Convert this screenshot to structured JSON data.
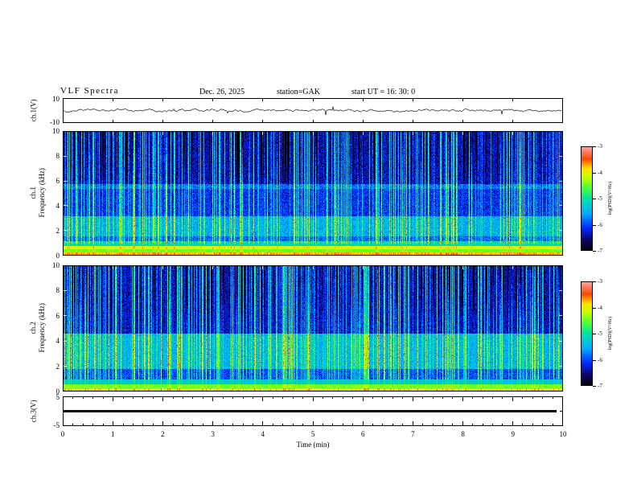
{
  "header": {
    "title": "VLF  Spectra",
    "date": "Dec. 26,  2025",
    "station": "station=GAK",
    "start_ut": "start UT  =   16: 30: 0"
  },
  "axes": {
    "x": {
      "label": "Time  (min)",
      "ticks": [
        "0",
        "1",
        "2",
        "3",
        "4",
        "5",
        "6",
        "7",
        "8",
        "9",
        "10"
      ],
      "lim": [
        0,
        10
      ]
    },
    "waveform_y": {
      "label": "ch.1(V)",
      "ticks": [
        "10",
        "-10"
      ],
      "lim": [
        -10,
        10
      ]
    },
    "spec1_y": {
      "label_channel": "ch.1",
      "label_axis": "Frequency (kHz)",
      "ticks": [
        "10",
        "8",
        "6",
        "4",
        "2",
        "0"
      ],
      "lim": [
        0,
        10
      ]
    },
    "spec2_y": {
      "label_channel": "ch.2",
      "label_axis": "Frequency (kHz)",
      "ticks": [
        "10",
        "8",
        "6",
        "4",
        "2",
        "0"
      ],
      "lim": [
        0,
        10
      ]
    },
    "ch3_y": {
      "label": "ch.3(V)",
      "ticks": [
        "5",
        "-5"
      ],
      "lim": [
        -5,
        5
      ]
    }
  },
  "colorbar": {
    "label": "log(PSD)(V²/Hz)",
    "ticks": [
      "-3",
      "-4",
      "-5",
      "-6",
      "-7"
    ],
    "lim": [
      -7,
      -3
    ],
    "colormap": "rainbow: black -> blue -> cyan -> green -> yellow -> red -> pink"
  },
  "chart_data": [
    {
      "type": "line",
      "name": "ch1-waveform",
      "title": "ch.1 time series",
      "xlabel": "Time (min)",
      "xlim": [
        0,
        10
      ],
      "ylabel": "ch.1(V)",
      "ylim": [
        -10,
        10
      ],
      "description": "Noisy broadband signal fluctuating about 0 V, typical amplitude within ±2 V, with frequent impulsive spikes up to roughly ±5 V over the full 10 minutes."
    },
    {
      "type": "heatmap",
      "name": "ch1-spectrogram",
      "title": "ch.1 spectrogram",
      "xlabel": "Time (min)",
      "xlim": [
        0,
        10
      ],
      "ylabel": "Frequency (kHz)",
      "ylim": [
        0,
        10
      ],
      "zlabel": "log(PSD)(V²/Hz)",
      "zlim": [
        -7,
        -3
      ],
      "base_psd": -6.35,
      "bands": [
        {
          "f": [
            0,
            0.3
          ],
          "psd": -3.8,
          "note": "intense continuous red/orange band at lowest frequencies"
        },
        {
          "f": [
            0.3,
            0.55
          ],
          "psd": -4.5,
          "note": "yellow stripe"
        },
        {
          "f": [
            0.55,
            0.8
          ],
          "psd": -4.1,
          "note": "second bright yellow/orange stripe"
        },
        {
          "f": [
            0.8,
            1.2
          ],
          "psd": -5.2
        },
        {
          "f": [
            1.2,
            1.6
          ],
          "psd": -5.9
        },
        {
          "f": [
            1.6,
            3.2
          ],
          "psd": -5.5,
          "note": "speckled cyan/green hiss band ~2-3 kHz"
        },
        {
          "f": [
            3.2,
            5.4
          ],
          "psd": -6.15
        },
        {
          "f": [
            5.4,
            5.8
          ],
          "psd": -5.85,
          "note": "faint narrow emission line near 5.6 kHz"
        },
        {
          "f": [
            5.8,
            10
          ],
          "psd": -6.4,
          "note": "dark blue background with black patches at 8-10 kHz"
        }
      ],
      "impulses": "dense vertical broadband streaks (sferics) spanning 0-10 kHz throughout"
    },
    {
      "type": "heatmap",
      "name": "ch2-spectrogram",
      "title": "ch.2 spectrogram",
      "xlabel": "Time (min)",
      "xlim": [
        0,
        10
      ],
      "ylabel": "Frequency (kHz)",
      "ylim": [
        0,
        10
      ],
      "zlabel": "log(PSD)(V²/Hz)",
      "zlim": [
        -7,
        -3
      ],
      "base_psd": -6.35,
      "bands": [
        {
          "f": [
            0,
            0.3
          ],
          "psd": -4.0,
          "note": "bright low-frequency band, yellow with red segments"
        },
        {
          "f": [
            0.3,
            0.6
          ],
          "psd": -4.5
        },
        {
          "f": [
            0.6,
            1.0
          ],
          "psd": -5.3
        },
        {
          "f": [
            1.0,
            1.8
          ],
          "psd": -6.0
        },
        {
          "f": [
            1.8,
            4.6
          ],
          "psd": -5.45,
          "note": "broad green hiss band ~2-4.5 kHz"
        },
        {
          "f": [
            4.6,
            10
          ],
          "psd": -6.35,
          "note": "blue background with dark columns at high frequency"
        }
      ],
      "impulses": "dense vertical broadband streaks (sferics) spanning 0-10 kHz throughout"
    },
    {
      "type": "line",
      "name": "ch3-waveform",
      "title": "ch.3 time series",
      "xlabel": "Time (min)",
      "xlim": [
        0,
        10
      ],
      "ylabel": "ch.3(V)",
      "ylim": [
        -5,
        5
      ],
      "description": "Flat constant trace at approximately 0 V across the entire 10 minute interval (thick dark line)."
    }
  ]
}
